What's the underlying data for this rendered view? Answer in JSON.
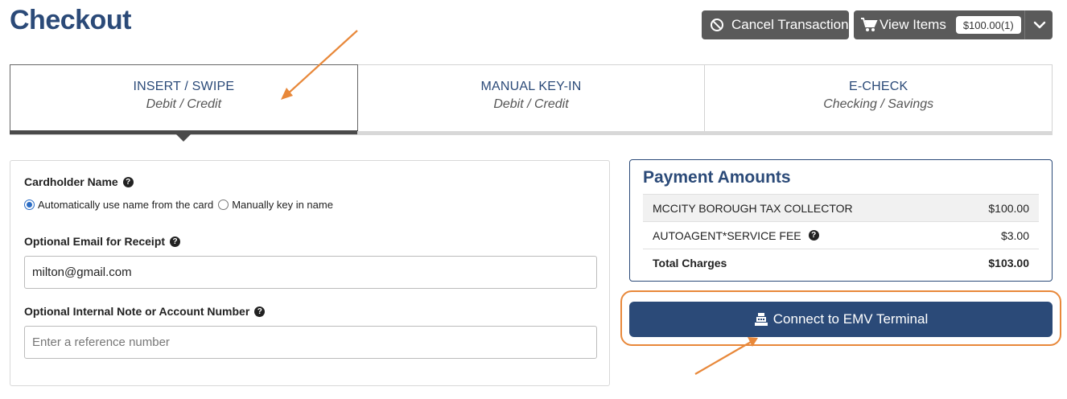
{
  "page": {
    "title": "Checkout"
  },
  "header": {
    "cancel_label": "Cancel Transaction",
    "view_items_label": "View Items",
    "view_items_badge": "$100.00(1)"
  },
  "tabs": [
    {
      "label": "INSERT / SWIPE",
      "sublabel": "Debit / Credit",
      "active": true
    },
    {
      "label": "MANUAL KEY-IN",
      "sublabel": "Debit / Credit",
      "active": false
    },
    {
      "label": "E-CHECK",
      "sublabel": "Checking / Savings",
      "active": false
    }
  ],
  "form": {
    "cardholder_label": "Cardholder Name",
    "radio_auto": "Automatically use name from the card",
    "radio_manual": "Manually key in name",
    "email_label": "Optional Email for Receipt",
    "email_value": "milton@gmail.com",
    "note_label": "Optional Internal Note or Account Number",
    "note_placeholder": "Enter a reference number"
  },
  "amounts": {
    "title": "Payment Amounts",
    "rows": [
      {
        "name": "MCCITY BOROUGH TAX COLLECTOR",
        "value": "$100.00"
      },
      {
        "name": "AUTOAGENT*SERVICE FEE",
        "value": "$3.00"
      }
    ],
    "total_label": "Total Charges",
    "total_value": "$103.00"
  },
  "emv": {
    "label": "Connect to EMV Terminal"
  },
  "colors": {
    "brand": "#2b4a78",
    "annotation": "#e8883a",
    "button_dark": "#5a5a5a"
  },
  "icons": [
    "ban-icon",
    "cart-icon",
    "chevron-down-icon",
    "help-icon",
    "cash-register-icon"
  ]
}
